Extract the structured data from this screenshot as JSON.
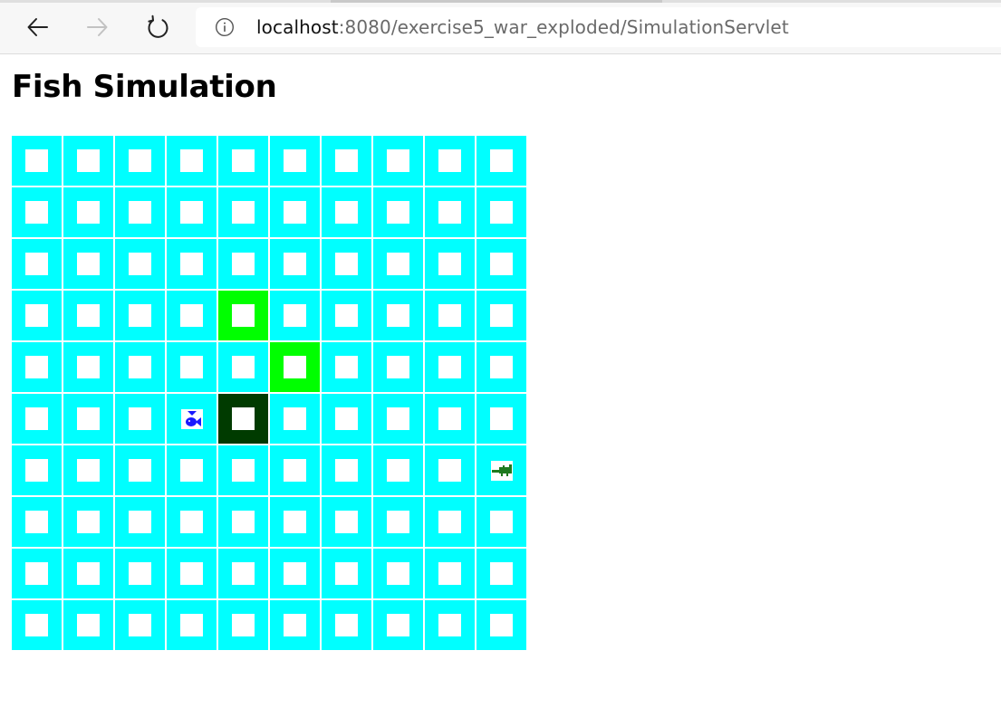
{
  "browser": {
    "url_host": "localhost",
    "url_path": ":8080/exercise5_war_exploded/SimulationServlet",
    "icons": {
      "back": "arrow-left-icon",
      "forward": "arrow-right-icon",
      "reload": "reload-icon",
      "site_info": "info-circle-icon"
    }
  },
  "page": {
    "title": "Fish Simulation"
  },
  "simulation": {
    "rows": 10,
    "cols": 10,
    "colors": {
      "water": "#00ffff",
      "plant": "#00ff00",
      "dense_plant": "#003b00",
      "fish": "#1a1aff",
      "predator": "#1f7a1f"
    },
    "special_cells": [
      {
        "row": 3,
        "col": 4,
        "type": "plant"
      },
      {
        "row": 4,
        "col": 5,
        "type": "plant"
      },
      {
        "row": 5,
        "col": 4,
        "type": "dense_plant"
      },
      {
        "row": 5,
        "col": 3,
        "type": "fish",
        "icon": "fish-icon"
      },
      {
        "row": 6,
        "col": 9,
        "type": "predator",
        "icon": "crocodile-icon"
      }
    ]
  }
}
